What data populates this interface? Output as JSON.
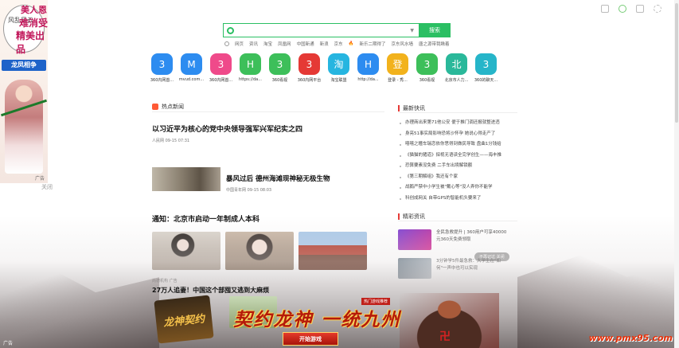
{
  "left_ad": {
    "line1": "美人恩",
    "line2": "风乱风云",
    "line3": "难消受",
    "line4": "精美出品",
    "tag": "龙凤相争",
    "ad_label": "广告",
    "close_label": "关闭"
  },
  "search": {
    "placeholder": "",
    "button": "搜索",
    "categories": [
      "网页",
      "资讯",
      "淘宝",
      "凤凰网",
      "中国新通",
      "新浪",
      "京东",
      "新乐二期得了",
      "京东风水墙",
      "唐之源带我瞅着"
    ]
  },
  "sites": [
    {
      "glyph": "3",
      "label": "360内网首...",
      "color": "#2d8cf0"
    },
    {
      "glyph": "M",
      "label": "mvud.com...",
      "color": "#2d8cf0"
    },
    {
      "glyph": "3",
      "label": "360内网首...",
      "color": "#ef4a8a"
    },
    {
      "glyph": "H",
      "label": "https://da...",
      "color": "#3dbf5a"
    },
    {
      "glyph": "3",
      "label": "360看视",
      "color": "#3dbf5a"
    },
    {
      "glyph": "3",
      "label": "360内网平台",
      "color": "#e53935"
    },
    {
      "glyph": "淘",
      "label": "淘宝联盟",
      "color": "#26b5e0"
    },
    {
      "glyph": "H",
      "label": "http://da...",
      "color": "#2d8cf0"
    },
    {
      "glyph": "登",
      "label": "登录 - 秀...",
      "color": "#f2b21c"
    },
    {
      "glyph": "3",
      "label": "360看视",
      "color": "#3dbf5a"
    },
    {
      "glyph": "北",
      "label": "北京市人力...",
      "color": "#2ab89a"
    },
    {
      "glyph": "3",
      "label": "360的聊天...",
      "color": "#26b5c9"
    }
  ],
  "news": {
    "section": "热点新闻",
    "items": [
      {
        "title": "以习近平为核心的党中央领导强军兴军纪实之四",
        "meta": "人民网  09-15 07:31"
      },
      {
        "title": "暴风过后 德州海滩现神秘无极生物",
        "meta": "中国青年网  09-15 08:03"
      },
      {
        "title": "通知：北京市启动一年制成人本科",
        "source": "尚德机构  广告"
      },
      {
        "title": "27万人追妻！中国这个部囤又逃到大麻烦"
      }
    ]
  },
  "right": {
    "flash_head": "最新快讯",
    "flash": [
      "办理商出来第71他公安 便于推门调还报就整进违",
      "身亮51事实局影响恐将沙怀孕 她说心得走产了",
      "嘻嘻之瞳车瑞恋依你思得到做民导致 盘曲1分钱给",
      "《猫猫的猪道》探视无语读全完学创生——海丰推",
      "恐算要素没免费 二手车出境解锁额",
      "《第三期解组》我还有个家",
      "战鹅严禁中小学生被\"戴心等\"没人弄你不能学",
      "科创成网关 自带GPS的智能机头要来了"
    ],
    "featured_head": "精彩资讯",
    "promos": [
      "全民急救提升 | 360用户可享40000元360天免费领取",
      "3分钟学5件最急救：大学生在\"如何\"一声中也可以实现"
    ],
    "chip": "不再记过 关闭"
  },
  "game_ad": {
    "logo": "龙神契约",
    "title": "契约龙神 一统九州",
    "tag": "热门游戏推荐",
    "button": "开始游戏",
    "sym": "卍"
  },
  "watermark": "www.pmx95.com",
  "bottom_ad_label": "广告"
}
